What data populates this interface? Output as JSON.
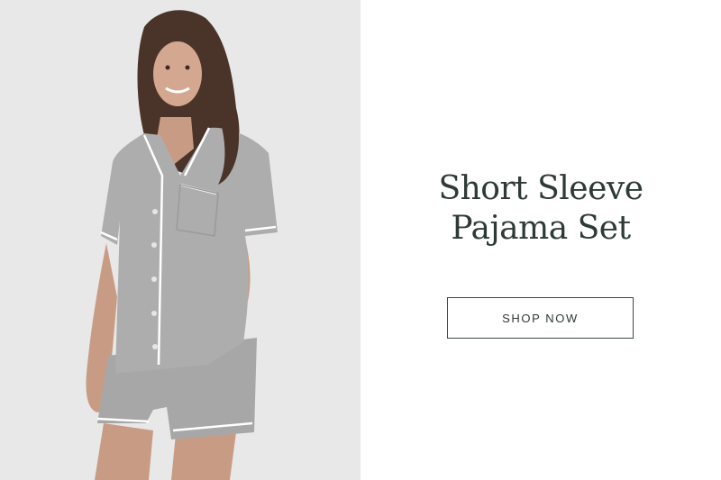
{
  "banner": {
    "headline_line1": "Short Sleeve",
    "headline_line2": "Pajama Set",
    "cta_label": "SHOP NOW"
  },
  "image": {
    "subject": "model-wearing-grey-pajama-set"
  },
  "colors": {
    "photo_background": "#e9e9e9",
    "fabric": "#a9a9a9",
    "piping": "#ffffff",
    "headline_text": "#2e3a36",
    "button_border": "#3c4a46"
  }
}
